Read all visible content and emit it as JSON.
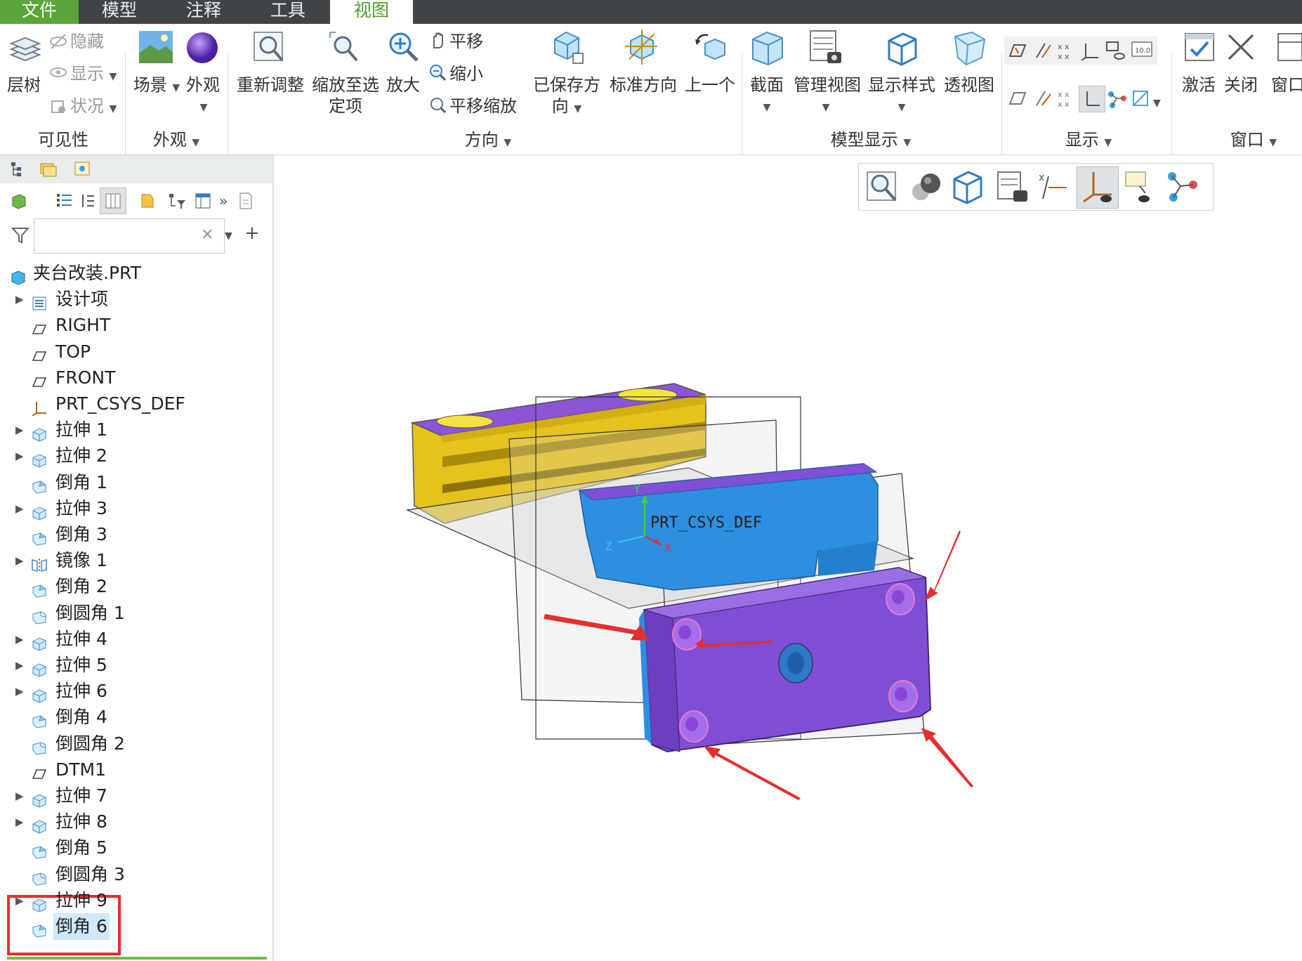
{
  "tabs": [
    {
      "label": "文件"
    },
    {
      "label": "模型"
    },
    {
      "label": "注释"
    },
    {
      "label": "工具"
    },
    {
      "label": "视图"
    }
  ],
  "ribbon": {
    "visibility": {
      "layer_tree": "层树",
      "hide": "隐藏",
      "show": "显示",
      "status": "状况",
      "group": "可见性"
    },
    "appearance": {
      "scene": "场景",
      "appearance": "外观",
      "group": "外观"
    },
    "orientation": {
      "refit": "重新调整",
      "zoom_selected_1": "缩放至选",
      "zoom_selected_2": "定项",
      "zoom_in": "放大",
      "pan": "平移",
      "zoom_out": "缩小",
      "pan_zoom": "平移缩放",
      "saved_1": "已保存方",
      "saved_2": "向",
      "standard": "标准方向",
      "previous": "上一个",
      "group": "方向"
    },
    "model_display": {
      "section": "截面",
      "manage_views": "管理视图",
      "display_style": "显示样式",
      "perspective": "透视图",
      "group": "模型显示"
    },
    "show": {
      "group": "显示",
      "badge": "10.0"
    },
    "window": {
      "activate": "激活",
      "close": "关闭",
      "window": "窗口",
      "group": "窗口"
    }
  },
  "model_tree": {
    "filter_placeholder": "",
    "clear": "×",
    "add": "+",
    "more": "»",
    "items": [
      {
        "label": "夹台改装.PRT",
        "icon": "part-icon",
        "expandable": false,
        "root": true
      },
      {
        "label": "设计项",
        "icon": "design-items-icon",
        "expandable": true
      },
      {
        "label": "RIGHT",
        "icon": "datum-plane-icon",
        "expandable": false
      },
      {
        "label": "TOP",
        "icon": "datum-plane-icon",
        "expandable": false
      },
      {
        "label": "FRONT",
        "icon": "datum-plane-icon",
        "expandable": false
      },
      {
        "label": "PRT_CSYS_DEF",
        "icon": "csys-icon",
        "expandable": false
      },
      {
        "label": "拉伸 1",
        "icon": "extrude-icon",
        "expandable": true
      },
      {
        "label": "拉伸 2",
        "icon": "extrude-icon",
        "expandable": true
      },
      {
        "label": "倒角 1",
        "icon": "chamfer-icon",
        "expandable": false
      },
      {
        "label": "拉伸 3",
        "icon": "extrude-icon",
        "expandable": true
      },
      {
        "label": "倒角 3",
        "icon": "chamfer-icon",
        "expandable": false
      },
      {
        "label": "镜像 1",
        "icon": "mirror-icon",
        "expandable": true
      },
      {
        "label": "倒角 2",
        "icon": "chamfer-icon",
        "expandable": false
      },
      {
        "label": "倒圆角 1",
        "icon": "round-icon",
        "expandable": false
      },
      {
        "label": "拉伸 4",
        "icon": "extrude-icon",
        "expandable": true
      },
      {
        "label": "拉伸 5",
        "icon": "extrude-icon",
        "expandable": true
      },
      {
        "label": "拉伸 6",
        "icon": "extrude-icon",
        "expandable": true
      },
      {
        "label": "倒角 4",
        "icon": "chamfer-icon",
        "expandable": false
      },
      {
        "label": "倒圆角 2",
        "icon": "round-icon",
        "expandable": false
      },
      {
        "label": "DTM1",
        "icon": "datum-plane-icon",
        "expandable": false
      },
      {
        "label": "拉伸 7",
        "icon": "extrude-icon",
        "expandable": true
      },
      {
        "label": "拉伸 8",
        "icon": "extrude-icon",
        "expandable": true
      },
      {
        "label": "倒角 5",
        "icon": "chamfer-icon",
        "expandable": false
      },
      {
        "label": "倒圆角 3",
        "icon": "round-icon",
        "expandable": false
      },
      {
        "label": "拉伸 9",
        "icon": "extrude-icon",
        "expandable": true
      },
      {
        "label": "倒角 6",
        "icon": "chamfer-icon",
        "expandable": false,
        "selected": true
      }
    ]
  },
  "viewport": {
    "csys_label": "PRT_CSYS_DEF",
    "axis_x": "X",
    "axis_y": "Y",
    "axis_z": "Z"
  },
  "colors": {
    "accent_green": "#5aa63a",
    "tabbar": "#3e4448",
    "yellow_part": "#e5c11c",
    "blue_part": "#2e8fe0",
    "purple_part": "#8150d8",
    "annotation_red": "#e52e2e"
  }
}
